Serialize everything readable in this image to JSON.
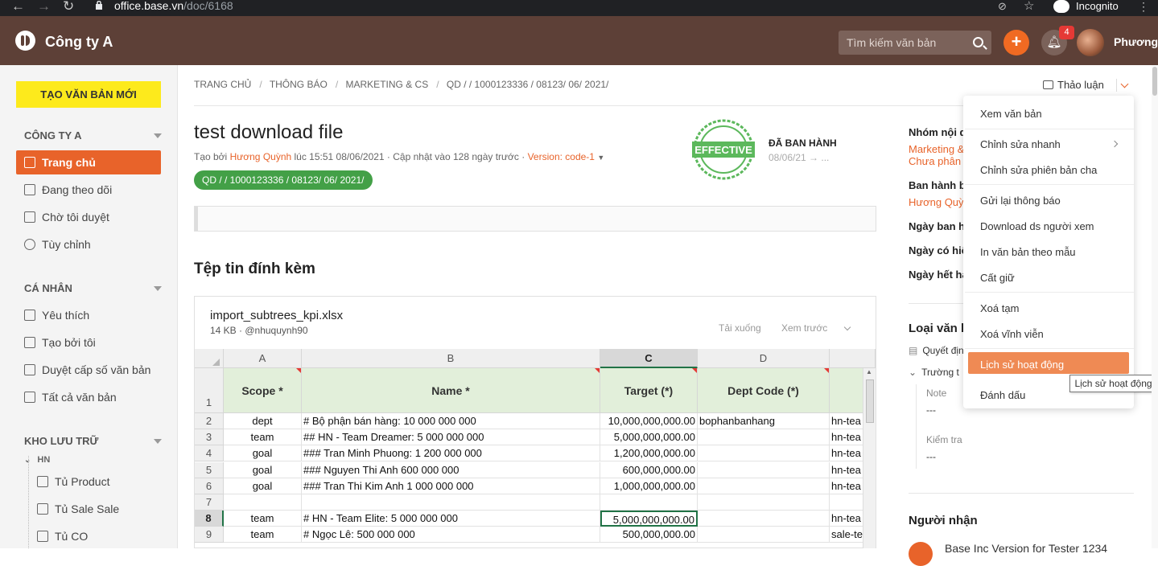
{
  "browser": {
    "url_host": "office.base.vn",
    "url_path": "/doc/6168",
    "incognito": "Incognito"
  },
  "header": {
    "company": "Công ty A",
    "search_placeholder": "Tìm kiếm văn bản",
    "notifications": "4",
    "user": "Phương"
  },
  "sidebar": {
    "new_doc": "TẠO VĂN BẢN MỚI",
    "sec1": "CÔNG TY A",
    "items1": [
      "Trang chủ",
      "Đang theo dõi",
      "Chờ tôi duyệt",
      "Tùy chỉnh"
    ],
    "sec2": "CÁ NHÂN",
    "items2": [
      "Yêu thích",
      "Tạo bởi tôi",
      "Duyệt cấp số văn bản",
      "Tất cả văn bản"
    ],
    "sec3": "KHO LƯU TRỮ",
    "folder": "HN",
    "items3": [
      "Tủ Product",
      "Tủ Sale Sale",
      "Tủ CO"
    ]
  },
  "breadcrumb": [
    "TRANG CHỦ",
    "THÔNG BÁO",
    "MARKETING & CS",
    "QD / / 1000123336 / 08123/ 06/ 2021/"
  ],
  "doc": {
    "title": "test download file",
    "meta_prefix": "Tạo bởi ",
    "author": "Hương Quỳnh",
    "meta_mid": " lúc 15:51 08/06/2021 · Cập nhật vào 128 ngày trước · ",
    "version": "Version: code-1",
    "tag": "QD / / 1000123336 / 08123/ 06/ 2021/",
    "stamp": "EFFECTIVE",
    "status": "ĐÃ BAN HÀNH",
    "status_date": "08/06/21 → ..."
  },
  "attachments": {
    "heading": "Tệp tin đính kèm",
    "file": "import_subtrees_kpi.xlsx",
    "size": "14 KB · @nhuquynh90",
    "download": "Tải xuống",
    "preview": "Xem trước"
  },
  "sheet": {
    "cols": [
      "A",
      "B",
      "C",
      "D"
    ],
    "headers": [
      "Scope  *",
      "Name  *",
      "Target (*)",
      "Dept Code (*)"
    ],
    "rownums": [
      "1",
      "2",
      "3",
      "4",
      "5",
      "6",
      "7",
      "8",
      "9"
    ],
    "rows": [
      [
        "dept",
        "# Bộ phận bán hàng: 10 000 000 000",
        "10,000,000,000.00",
        "bophanbanhang",
        "hn-tea"
      ],
      [
        "team",
        "## HN - Team Dreamer: 5 000 000 000",
        "5,000,000,000.00",
        "",
        "hn-tea"
      ],
      [
        "goal",
        "### Tran Minh Phuong: 1 200 000 000",
        "1,200,000,000.00",
        "",
        "hn-tea"
      ],
      [
        "goal",
        "### Nguyen Thi Anh 600 000 000",
        "600,000,000.00",
        "",
        "hn-tea"
      ],
      [
        "goal",
        "### Tran Thi Kim Anh 1 000 000 000",
        "1,000,000,000.00",
        "",
        "hn-tea"
      ],
      [
        "",
        "",
        "",
        "",
        ""
      ],
      [
        "team",
        "# HN - Team Elite: 5 000 000 000",
        "5,000,000,000.00",
        "",
        "hn-tea"
      ],
      [
        "team",
        "# Ngọc Lê: 500 000 000",
        "500,000,000.00",
        "",
        "sale-te"
      ]
    ]
  },
  "right": {
    "nhom": "Nhóm nội d",
    "nhom_val1": "Marketing &",
    "nhom_val2": "Chưa phân l",
    "banhanh": "Ban hành bở",
    "banhanh_val": "Hương Quỳn",
    "ngaybh": "Ngày ban hà",
    "ngayhl": "Ngày có hiệ",
    "ngayhh": "Ngày hết hạ",
    "loai": "Loại văn b",
    "quyetdinh": "Quyết địn",
    "truong": "Trường t",
    "note": "Note",
    "note_val": "---",
    "kiemtra": "Kiểm tra",
    "kiemtra_val": "---",
    "nguoinhan": "Người nhận",
    "recipient": "Base Inc Version for Tester 1234"
  },
  "actions": {
    "discuss": "Thảo luận"
  },
  "menu": [
    "Xem văn bản",
    "Chỉnh sửa nhanh",
    "Chỉnh sửa phiên bản cha",
    "Gửi lại thông báo",
    "Download ds người xem",
    "In văn bản theo mẫu",
    "Cất giữ",
    "Xoá tạm",
    "Xoá vĩnh viễn",
    "Lịch sử hoạt động",
    "Đánh dấu"
  ],
  "tooltip": "Lịch sử hoạt động",
  "colors": {
    "brand": "#5d4037",
    "accent": "#e8632a",
    "yellow": "#fdea1c",
    "green": "#43a047"
  }
}
